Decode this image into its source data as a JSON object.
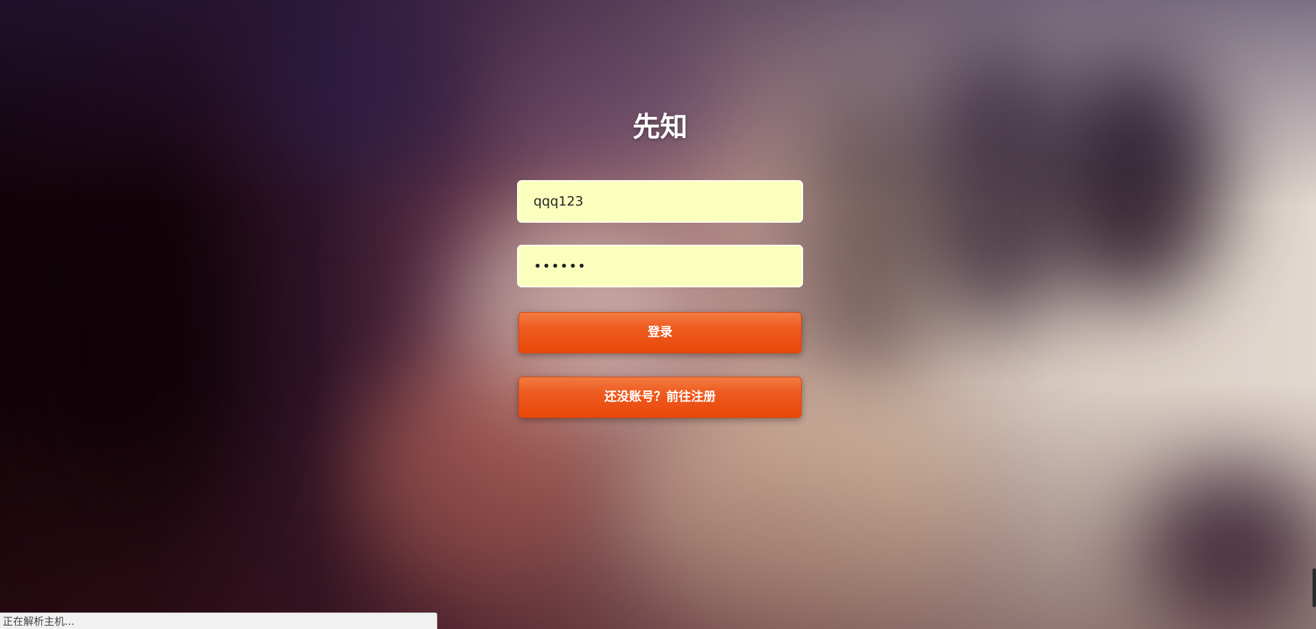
{
  "login": {
    "title": "先知",
    "username_value": "qqq123",
    "password_value": "••••••",
    "login_button": "登录",
    "register_button": "还没账号？前往注册"
  },
  "status_bar": {
    "text": "正在解析主机..."
  },
  "colors": {
    "input_background": "#faffbd",
    "button_orange": "#ee5a1e",
    "title_text": "#ffffff"
  }
}
